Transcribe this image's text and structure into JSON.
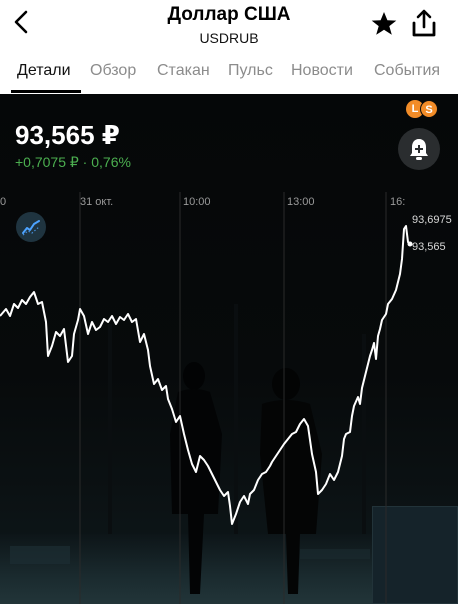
{
  "header": {
    "title": "Доллар США",
    "ticker": "USDRUB",
    "back_icon": "chevron-left-icon",
    "favorite_icon": "star-icon",
    "share_icon": "share-icon"
  },
  "tabs": [
    {
      "label": "Детали",
      "active": true
    },
    {
      "label": "Обзор",
      "active": false
    },
    {
      "label": "Стакан",
      "active": false
    },
    {
      "label": "Пульс",
      "active": false
    },
    {
      "label": "Новости",
      "active": false
    },
    {
      "label": "События",
      "active": false
    }
  ],
  "quote": {
    "price": "93,565 ₽",
    "change": "+0,7075 ₽ · 0,76%"
  },
  "badges": {
    "l": "L",
    "s": "S"
  },
  "chart": {
    "time_labels": [
      "0",
      "31 окт.",
      "10:00",
      "13:00",
      "16:"
    ],
    "price_high_label": "93,6975",
    "price_last_label": "93,565",
    "line_color": "#ffffff",
    "positive_color": "#4caf50",
    "accent_color": "#f28c28"
  }
}
